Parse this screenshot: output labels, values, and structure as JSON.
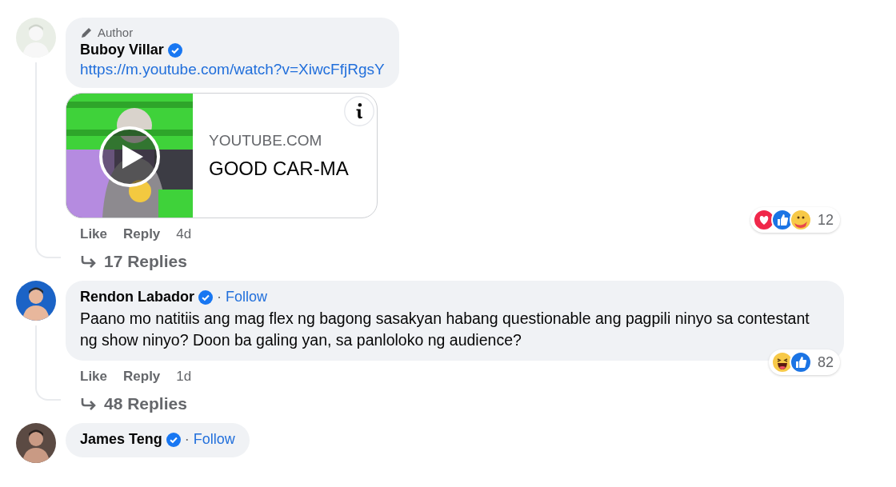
{
  "comments": [
    {
      "badge": "Author",
      "author": "Buboy Villar",
      "verified": true,
      "link": "https://m.youtube.com/watch?v=XiwcFfjRgsY",
      "link_preview": {
        "domain": "YOUTUBE.COM",
        "title": "GOOD CAR-MA"
      },
      "actions": {
        "like": "Like",
        "reply": "Reply",
        "time": "4d"
      },
      "reactions": {
        "types": [
          {
            "kind": "love"
          },
          {
            "kind": "like"
          },
          {
            "kind": "care"
          }
        ],
        "count": "12"
      },
      "replies": "17 Replies"
    },
    {
      "author": "Rendon Labador",
      "verified": true,
      "separator": "·",
      "follow": "Follow",
      "text": "Paano mo natitiis ang mag flex ng bagong sasakyan habang questionable ang pagpili ninyo sa contestant ng show ninyo? Doon ba galing yan, sa panloloko ng audience?",
      "actions": {
        "like": "Like",
        "reply": "Reply",
        "time": "1d"
      },
      "reactions": {
        "types": [
          {
            "kind": "haha"
          },
          {
            "kind": "like"
          }
        ],
        "count": "82"
      },
      "replies": "48 Replies"
    },
    {
      "author": "James Teng",
      "verified": true,
      "separator": "·",
      "follow": "Follow"
    }
  ]
}
